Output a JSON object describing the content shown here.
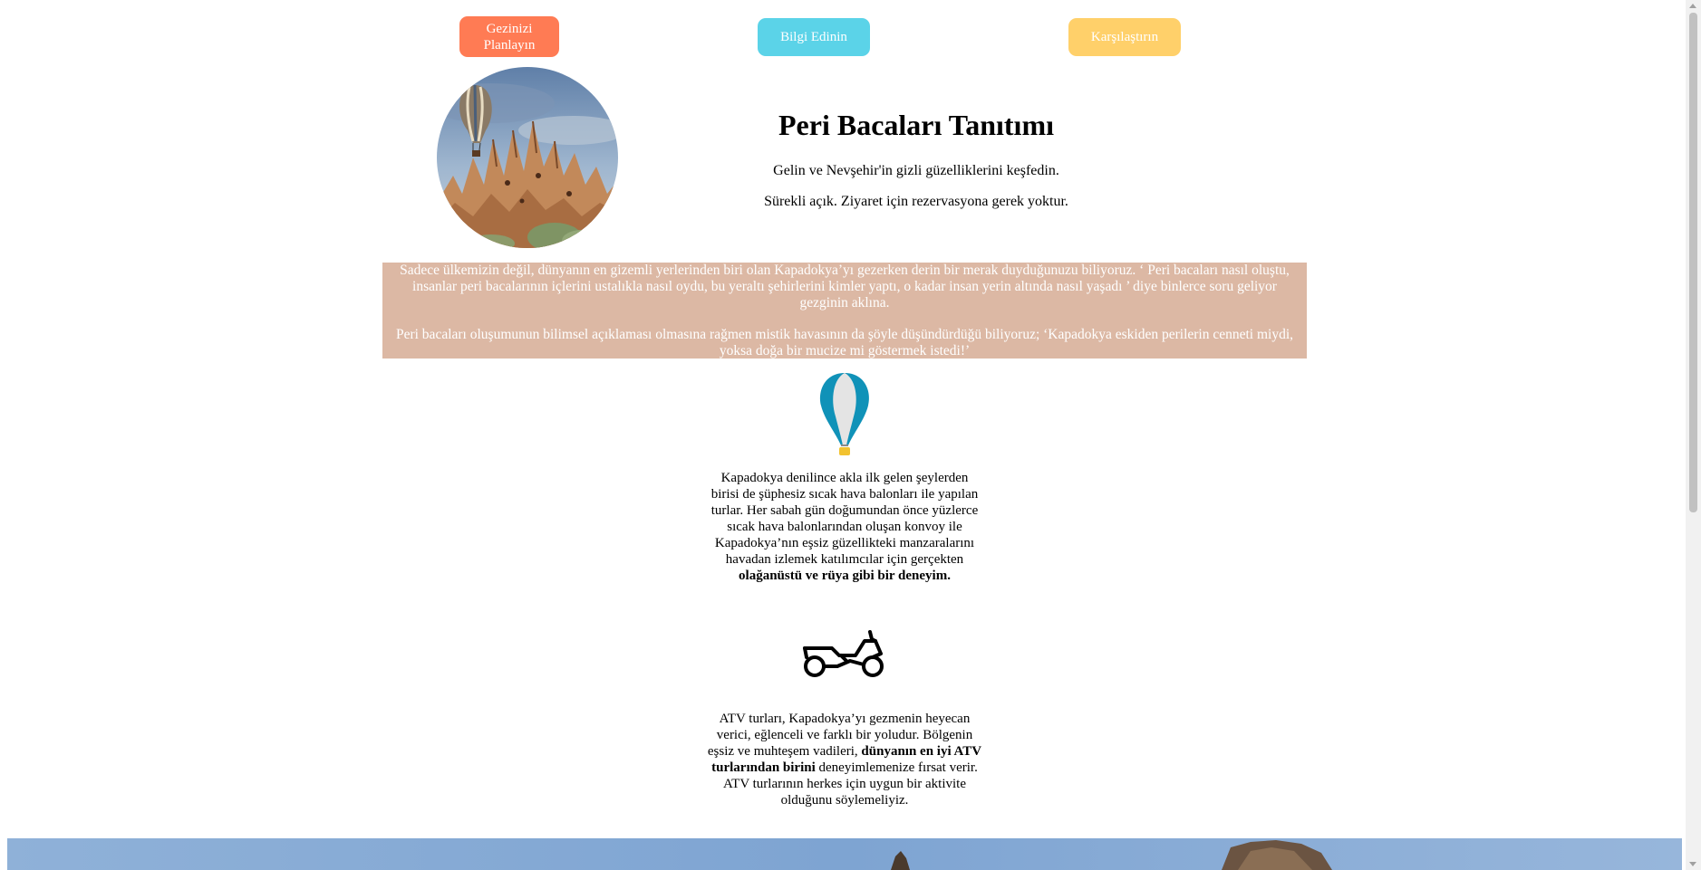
{
  "nav": {
    "plan_label": "Gezinizi Planlayın",
    "info_label": "Bilgi Edinin",
    "compare_label": "Karşılaştırın",
    "colors": {
      "plan": "#ff7b54",
      "info": "#5bd3e8",
      "compare": "#ffd06a"
    }
  },
  "hero": {
    "title": "Peri Bacaları Tanıtımı",
    "subtitle": "Gelin ve Nevşehir'in gizli güzelliklerini keşfedin.",
    "hours_note": "Sürekli açık. Ziyaret için rezervasyona gerek yoktur.",
    "image_icon": "fairy-chimneys-balloon-photo"
  },
  "intro": {
    "paragraph1": "Sadece ülkemizin değil, dünyanın en gizemli yerlerinden biri olan Kapadokya’yı gezerken derin bir merak duyduğunuzu biliyoruz. ‘ Peri bacaları nasıl oluştu, insanlar peri bacalarının içlerini ustalıkla nasıl oydu, bu yeraltı şehirlerini kimler yaptı, o kadar insan yerin altında nasıl yaşadı ’ diye binlerce soru geliyor gezginin aklına.",
    "paragraph2": "Peri bacaları oluşumunun bilimsel açıklaması olmasına rağmen mistik havasının da şöyle düşündürdüğü biliyoruz; ‘Kapadokya eskiden perilerin cenneti miydi, yoksa doğa bir mucize mi göstermek istedi!’",
    "background_color": "#dcb8a4"
  },
  "balloon_section": {
    "icon": "hot-air-balloon-icon",
    "text_plain": "Kapadokya denilince akla ilk gelen şeylerden birisi de şüphesiz sıcak hava balonları ile yapılan turlar. Her sabah gün doğumundan önce yüzlerce sıcak hava balonlarından oluşan konvoy ile Kapadokya’nın eşsiz güzellikteki manzaralarını havadan izlemek katılımcılar için gerçekten",
    "text_bold": "olağanüstü ve rüya gibi bir deneyim."
  },
  "atv_section": {
    "icon": "atv-motorbike-icon",
    "text_before": "ATV turları, Kapadokya’yı gezmenin heyecan verici, eğlenceli ve farklı bir yoludur. Bölgenin eşsiz ve muhteşem vadileri,",
    "text_bold": "dünyanın en iyi ATV turlarından birini",
    "text_after": "deneyimlemenize fırsat verir. ATV turlarının herkes için uygun bir aktivite olduğunu söylemeliyiz."
  },
  "bottom_banner": {
    "image_icon": "cappadocia-landscape-photo"
  }
}
